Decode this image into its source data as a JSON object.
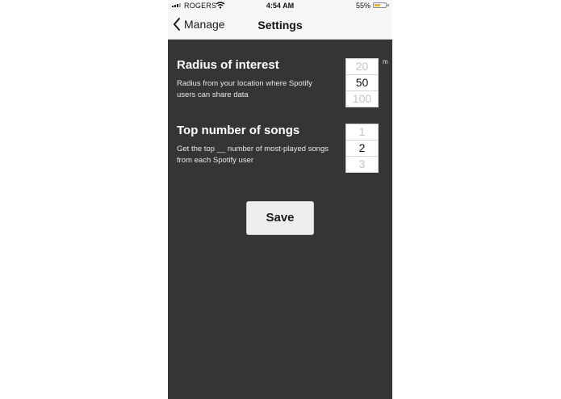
{
  "status_bar": {
    "carrier": "ROGERS",
    "time": "4:54 AM",
    "battery_percent": "55%",
    "battery_level": 0.55,
    "signal_icon": "signal-bars-icon",
    "wifi_icon": "wifi-icon"
  },
  "nav": {
    "back_label": "Manage",
    "back_icon": "chevron-left-icon",
    "title": "Settings"
  },
  "radius": {
    "title": "Radius of interest",
    "description": "Radius from your location where Spotify users can share data",
    "options": [
      "20",
      "50",
      "100"
    ],
    "selected": "50",
    "unit": "m"
  },
  "songs": {
    "title": "Top number of songs",
    "description": "Get the top __ number of most-played songs from each Spotify user",
    "options": [
      "1",
      "2",
      "3"
    ],
    "selected": "2"
  },
  "save_label": "Save",
  "colors": {
    "background": "#353535",
    "bar": "#f7f7f7",
    "button": "#eeeeee",
    "battery": "#e6b800"
  }
}
